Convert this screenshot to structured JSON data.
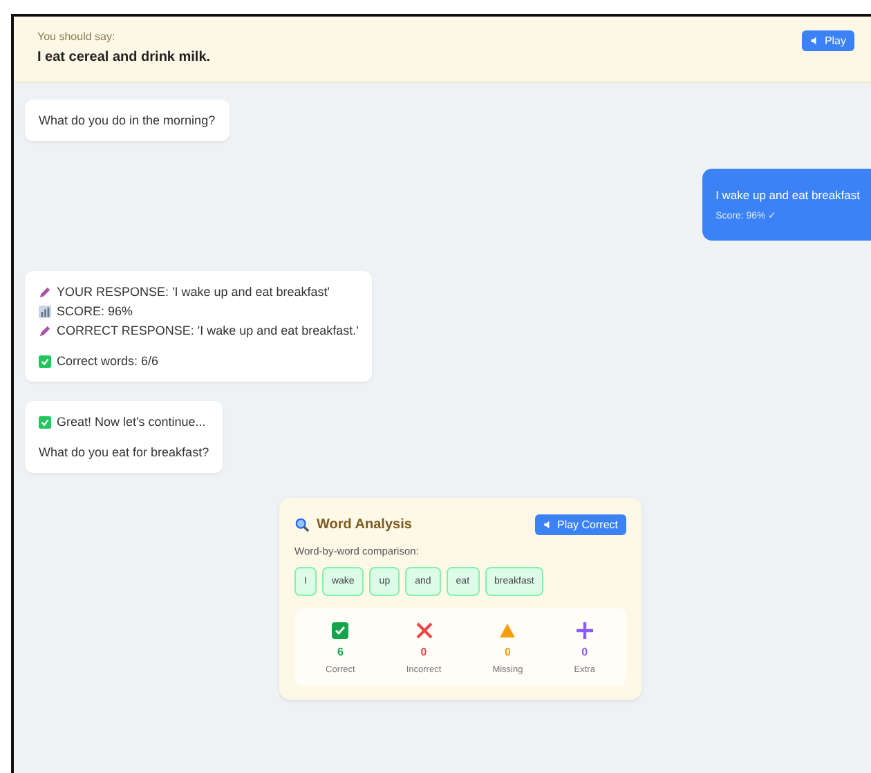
{
  "prompt": {
    "label": "You should say:",
    "sentence": "I eat cereal and drink milk.",
    "play_button": "Play"
  },
  "messages": [
    {
      "kind": "bot",
      "paragraphs": [
        {
          "lines": [
            {
              "kind": "plain",
              "text": "What do you do in the morning?"
            }
          ]
        }
      ]
    },
    {
      "kind": "user",
      "text": "I wake up and eat breakfast",
      "score": "Score: 96% ✓"
    },
    {
      "kind": "bot",
      "paragraphs": [
        {
          "lines": [
            {
              "kind": "response",
              "text": "YOUR RESPONSE: 'I wake up and eat breakfast'"
            },
            {
              "kind": "score",
              "text": "SCORE: 96%"
            },
            {
              "kind": "response",
              "text": "CORRECT RESPONSE: 'I wake up and eat breakfast.'"
            }
          ]
        },
        {
          "lines": [
            {
              "kind": "success",
              "text": "Correct words: 6/6"
            }
          ]
        }
      ]
    },
    {
      "kind": "bot",
      "paragraphs": [
        {
          "lines": [
            {
              "kind": "success",
              "text": "Great! Now let's continue..."
            }
          ]
        },
        {
          "lines": [
            {
              "kind": "plain",
              "text": "What do you eat for breakfast?"
            }
          ]
        }
      ]
    }
  ],
  "analysis": {
    "title": "Word Analysis",
    "play_button": "Play Correct",
    "subtitle": "Word-by-word comparison:",
    "words": [
      {
        "text": "I",
        "correct": true
      },
      {
        "text": "wake",
        "correct": true
      },
      {
        "text": "up",
        "correct": true
      },
      {
        "text": "and",
        "correct": true
      },
      {
        "text": "eat",
        "correct": true
      },
      {
        "text": "breakfast",
        "correct": true
      }
    ],
    "stats": [
      {
        "kind": "correct",
        "count": "6",
        "label": "Correct",
        "color": "#16a34a"
      },
      {
        "kind": "incorrect",
        "count": "0",
        "label": "Incorrect",
        "color": "#ef4444"
      },
      {
        "kind": "missing",
        "count": "0",
        "label": "Missing",
        "color": "#f59e0b"
      },
      {
        "kind": "extra",
        "count": "0",
        "label": "Extra",
        "color": "#8b5cf6"
      }
    ]
  }
}
